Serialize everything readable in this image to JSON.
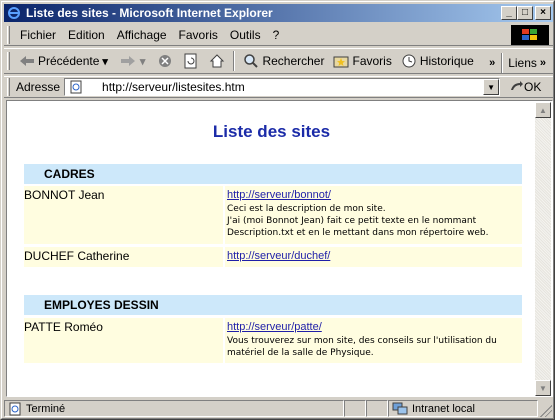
{
  "window": {
    "title": "Liste des sites - Microsoft Internet Explorer"
  },
  "menu": [
    "Fichier",
    "Edition",
    "Affichage",
    "Favoris",
    "Outils",
    "?"
  ],
  "toolbar": {
    "back_label": "Précédente",
    "search_label": "Rechercher",
    "favorites_label": "Favoris",
    "history_label": "Historique",
    "links_label": "Liens",
    "chevron": "»"
  },
  "address": {
    "label": "Adresse",
    "url": "http://serveur/listesites.htm",
    "go_label": "OK"
  },
  "page": {
    "title": "Liste des sites",
    "sections": [
      {
        "name": "CADRES",
        "entries": [
          {
            "person": "BONNOT Jean",
            "link": "http://serveur/bonnot/",
            "description": [
              "Ceci est la description de mon site.",
              "J'ai (moi Bonnot Jean) fait ce petit texte en le nommant",
              "Description.txt et en le mettant dans mon répertoire web."
            ]
          },
          {
            "person": "DUCHEF Catherine",
            "link": "http://serveur/duchef/",
            "description": []
          }
        ]
      },
      {
        "name": "EMPLOYES DESSIN",
        "entries": [
          {
            "person": "PATTE Roméo",
            "link": "http://serveur/patte/",
            "description": [
              "Vous trouverez sur mon site, des conseils sur l'utilisation du",
              "matériel de la salle de Physique."
            ]
          }
        ]
      }
    ]
  },
  "status": {
    "text": "Terminé",
    "zone": "Intranet local"
  },
  "colors": {
    "title_blue": "#1b2ba8",
    "section_bg": "#cde8fa",
    "row_bg": "#fffde0",
    "link": "#1f1fa8"
  }
}
